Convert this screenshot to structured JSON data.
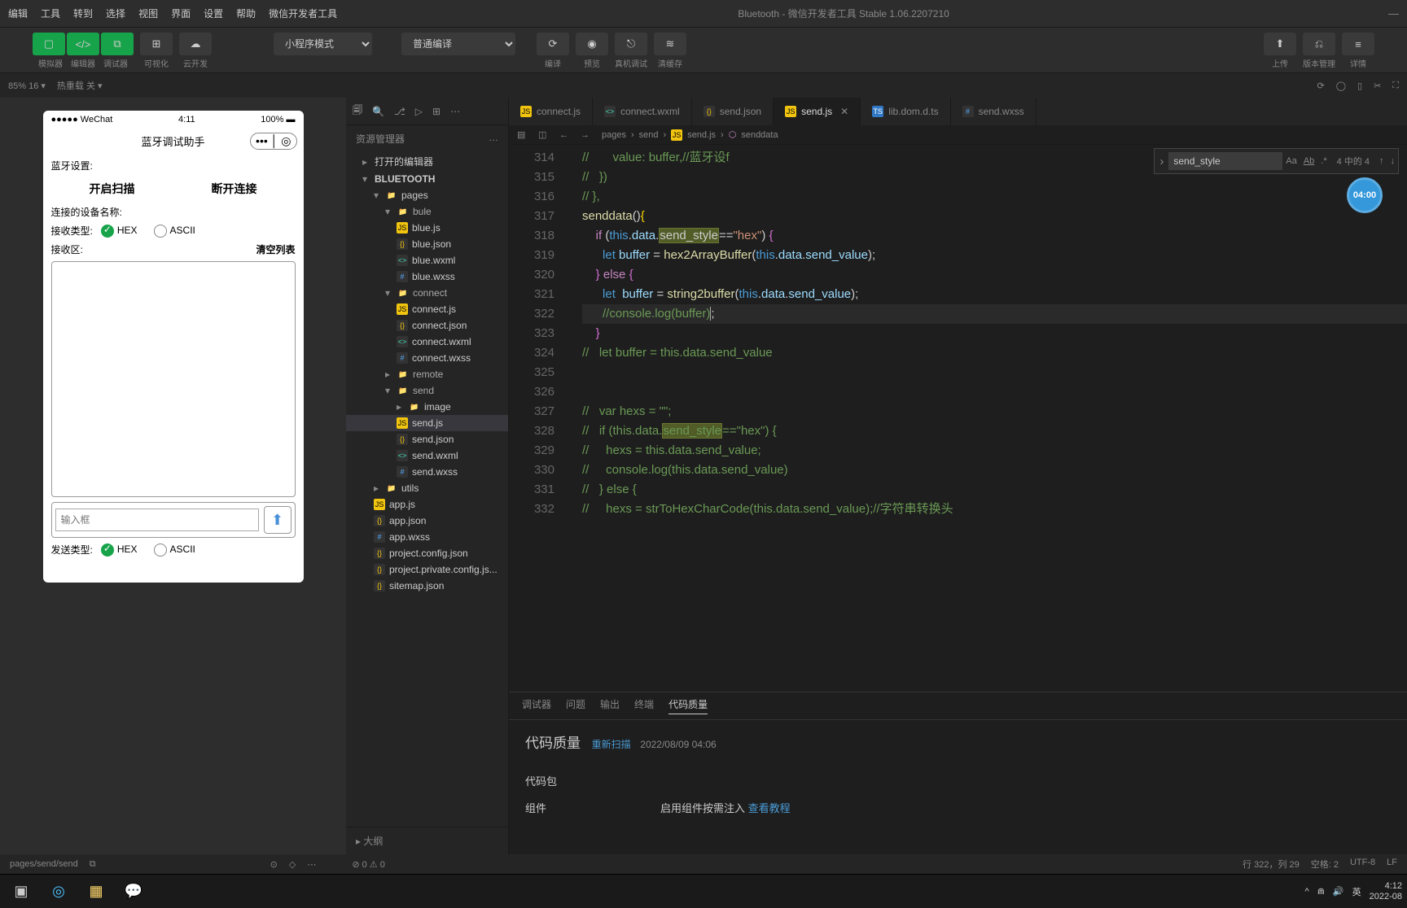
{
  "titlebar": {
    "menus": [
      "编辑",
      "工具",
      "转到",
      "选择",
      "视图",
      "界面",
      "设置",
      "帮助",
      "微信开发者工具"
    ],
    "title": "Bluetooth - 微信开发者工具 Stable 1.06.2207210"
  },
  "toolbar": {
    "left": [
      "模拟器",
      "编辑器",
      "调试器"
    ],
    "vis": "可视化",
    "cloud": "云开发",
    "mode": "小程序模式",
    "compile": "普通编译",
    "actions": [
      "编译",
      "预览",
      "真机调试",
      "清缓存"
    ],
    "right": [
      "上传",
      "版本管理",
      "详情"
    ]
  },
  "status1": {
    "zoom": "85% 16 ▾",
    "hot": "热重载 关 ▾"
  },
  "phone": {
    "status_l": "●●●●● WeChat",
    "status_c": "4:11",
    "status_r": "100%",
    "title": "蓝牙调试助手",
    "bt_label": "蓝牙设置:",
    "start": "开启扫描",
    "stop": "断开连接",
    "dev_label": "连接的设备名称:",
    "recv_type": "接收类型:",
    "hex": "HEX",
    "ascii": "ASCII",
    "recv_area": "接收区:",
    "clear": "清空列表",
    "input_ph": "输入框",
    "send_type": "发送类型:"
  },
  "explorer": {
    "header": "资源管理器",
    "open_editors": "打开的编辑器",
    "root": "BLUETOOTH",
    "tree": {
      "pages": {
        "label": "pages",
        "children": {
          "bule": {
            "label": "bule",
            "files": [
              "blue.js",
              "blue.json",
              "blue.wxml",
              "blue.wxss"
            ]
          },
          "connect": {
            "label": "connect",
            "files": [
              "connect.js",
              "connect.json",
              "connect.wxml",
              "connect.wxss"
            ]
          },
          "remote": {
            "label": "remote"
          },
          "send": {
            "label": "send",
            "children": {
              "image": "image"
            },
            "files": [
              "send.js",
              "send.json",
              "send.wxml",
              "send.wxss"
            ]
          }
        }
      },
      "utils": "utils",
      "files": [
        "app.js",
        "app.json",
        "app.wxss",
        "project.config.json",
        "project.private.config.js...",
        "sitemap.json"
      ]
    },
    "outline": "大纲"
  },
  "tabs": {
    "items": [
      {
        "icon": "js",
        "label": "connect.js"
      },
      {
        "icon": "wxml",
        "label": "connect.wxml"
      },
      {
        "icon": "json",
        "label": "send.json"
      },
      {
        "icon": "js",
        "label": "send.js",
        "active": true,
        "close": true
      },
      {
        "icon": "ts",
        "label": "lib.dom.d.ts"
      },
      {
        "icon": "wxss",
        "label": "send.wxss"
      }
    ]
  },
  "breadcrumb": [
    "pages",
    "send",
    "send.js",
    "senddata"
  ],
  "find": {
    "value": "send_style",
    "count": "4 中的 4"
  },
  "timer": "04:00",
  "code": {
    "start": 314,
    "lines": [
      {
        "n": 314,
        "t": "//       value: buffer,//蓝牙设f",
        "cls": "c"
      },
      {
        "n": 315,
        "t": "//   })",
        "cls": "c"
      },
      {
        "n": 316,
        "t": "// },",
        "cls": "c"
      },
      {
        "n": 317,
        "raw": "senddata"
      },
      {
        "n": 318,
        "raw": "if"
      },
      {
        "n": 319,
        "raw": "let1"
      },
      {
        "n": 320,
        "raw": "else"
      },
      {
        "n": 321,
        "raw": "let2"
      },
      {
        "n": 322,
        "raw": "console",
        "hl": true
      },
      {
        "n": 323,
        "raw": "brace"
      },
      {
        "n": 324,
        "t": "//   let buffer = this.data.send_value",
        "cls": "c"
      },
      {
        "n": 325,
        "t": ""
      },
      {
        "n": 326,
        "t": ""
      },
      {
        "n": 327,
        "t": "//   var hexs = \"\";",
        "cls": "c"
      },
      {
        "n": 328,
        "raw": "ifhex"
      },
      {
        "n": 329,
        "t": "//     hexs = this.data.send_value;",
        "cls": "c"
      },
      {
        "n": 330,
        "t": "//     console.log(this.data.send_value)",
        "cls": "c"
      },
      {
        "n": 331,
        "t": "//   } else {",
        "cls": "c"
      },
      {
        "n": 332,
        "t": "//     hexs = strToHexCharCode(this.data.send_value);//字符串转换头",
        "cls": "c"
      }
    ]
  },
  "panel": {
    "tabs": [
      "调试器",
      "问题",
      "输出",
      "终端",
      "代码质量"
    ],
    "active": 4,
    "quality_title": "代码质量",
    "rescan": "重新扫描",
    "time": "2022/08/09 04:06",
    "package": "代码包",
    "component": "组件",
    "inject": "启用组件按需注入",
    "tutorial": "查看教程"
  },
  "statusbar": {
    "path": "pages/send/send",
    "warn": "⊘ 0 ⚠ 0",
    "pos": "行 322，列 29",
    "spaces": "空格: 2",
    "enc": "UTF-8",
    "eol": "LF"
  },
  "taskbar": {
    "time": "4:12",
    "date": "2022-08",
    "ime": "英"
  }
}
